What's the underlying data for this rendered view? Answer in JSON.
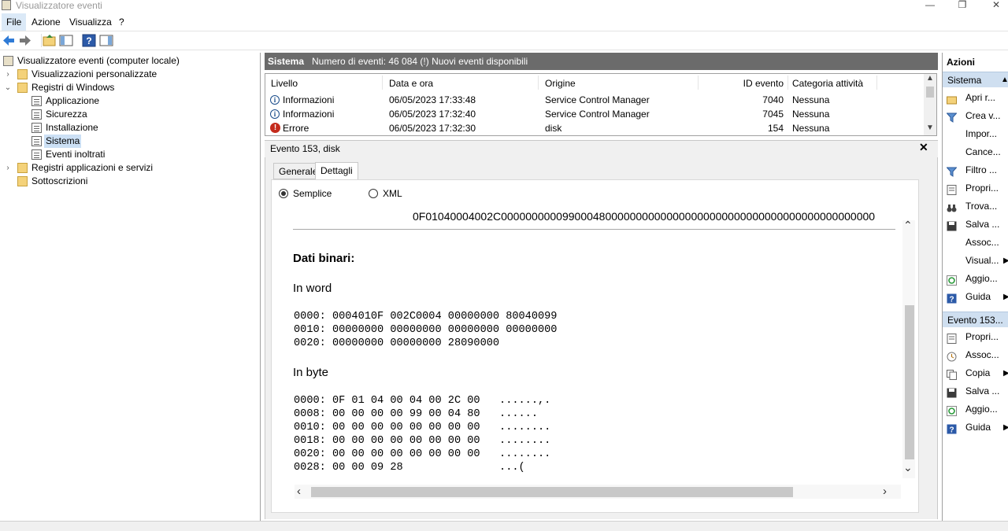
{
  "window": {
    "title": "Visualizzatore eventi",
    "controls": [
      "minimize",
      "restore",
      "close"
    ]
  },
  "menu": [
    "File",
    "Azione",
    "Visualizza",
    "?"
  ],
  "tree": {
    "root": "Visualizzatore eventi (computer locale)",
    "custom_views": "Visualizzazioni personalizzate",
    "windows_logs": "Registri di Windows",
    "logs": [
      "Applicazione",
      "Sicurezza",
      "Installazione",
      "Sistema",
      "Eventi inoltrati"
    ],
    "selected": "Sistema",
    "apps_services": "Registri applicazioni e servizi",
    "subscriptions": "Sottoscrizioni"
  },
  "header": {
    "log_name": "Sistema",
    "info": "Numero di eventi: 46 084 (!) Nuovi eventi disponibili"
  },
  "events": {
    "columns": [
      "Livello",
      "Data e ora",
      "Origine",
      "ID evento",
      "Categoria attività"
    ],
    "rows": [
      {
        "level": "Informazioni",
        "icon": "info-icon",
        "date": "06/05/2023 17:33:48",
        "source": "Service Control Manager",
        "id": "7040",
        "category": "Nessuna"
      },
      {
        "level": "Informazioni",
        "icon": "info-icon",
        "date": "06/05/2023 17:32:40",
        "source": "Service Control Manager",
        "id": "7045",
        "category": "Nessuna"
      },
      {
        "level": "Errore",
        "icon": "error-icon",
        "date": "06/05/2023 17:32:30",
        "source": "disk",
        "id": "154",
        "category": "Nessuna"
      }
    ]
  },
  "detail": {
    "title": "Evento 153, disk",
    "tabs": [
      "Generale",
      "Dettagli"
    ],
    "active_tab": "Dettagli",
    "view_options": [
      "Semplice",
      "XML"
    ],
    "selected_view": "Semplice",
    "hex_string": "0F01040004002C0000000000990004800000000000000000000000000000000000000000000",
    "binary_title": "Dati binari:",
    "words_title": "In word",
    "words_lines": [
      "0000: 0004010F 002C0004 00000000 80040099",
      "0010: 00000000 00000000 00000000 00000000",
      "0020: 00000000 00000000 28090000"
    ],
    "bytes_title": "In byte",
    "bytes_lines": [
      "0000: 0F 01 04 00 04 00 2C 00   ......,.",
      "0008: 00 00 00 00 99 00 04 80   ......",
      "0010: 00 00 00 00 00 00 00 00   ........",
      "0018: 00 00 00 00 00 00 00 00   ........",
      "0020: 00 00 00 00 00 00 00 00   ........",
      "0028: 00 00 09 28               ...("
    ]
  },
  "actions": {
    "title": "Azioni",
    "section1": "Sistema",
    "items1": [
      {
        "label": "Apri r...",
        "icon": "open-folder-icon",
        "submenu": false
      },
      {
        "label": "Crea v...",
        "icon": "filter-icon",
        "submenu": false
      },
      {
        "label": "Impor...",
        "icon": "",
        "submenu": false
      },
      {
        "label": "Cance...",
        "icon": "",
        "submenu": false
      },
      {
        "label": "Filtro ...",
        "icon": "filter-icon",
        "submenu": false
      },
      {
        "label": "Propri...",
        "icon": "properties-icon",
        "submenu": false
      },
      {
        "label": "Trova...",
        "icon": "binoculars-icon",
        "submenu": false
      },
      {
        "label": "Salva ...",
        "icon": "save-icon",
        "submenu": false
      },
      {
        "label": "Assoc...",
        "icon": "",
        "submenu": false
      },
      {
        "label": "Visual...",
        "icon": "",
        "submenu": true
      },
      {
        "label": "Aggio...",
        "icon": "refresh-icon",
        "submenu": false
      },
      {
        "label": "Guida",
        "icon": "help-icon",
        "submenu": true
      }
    ],
    "section2": "Evento 153...",
    "items2": [
      {
        "label": "Propri...",
        "icon": "properties-icon",
        "submenu": false
      },
      {
        "label": "Assoc...",
        "icon": "task-icon",
        "submenu": false
      },
      {
        "label": "Copia",
        "icon": "copy-icon",
        "submenu": true
      },
      {
        "label": "Salva ...",
        "icon": "save-icon",
        "submenu": false
      },
      {
        "label": "Aggio...",
        "icon": "refresh-icon",
        "submenu": false
      },
      {
        "label": "Guida",
        "icon": "help-icon",
        "submenu": true
      }
    ]
  }
}
